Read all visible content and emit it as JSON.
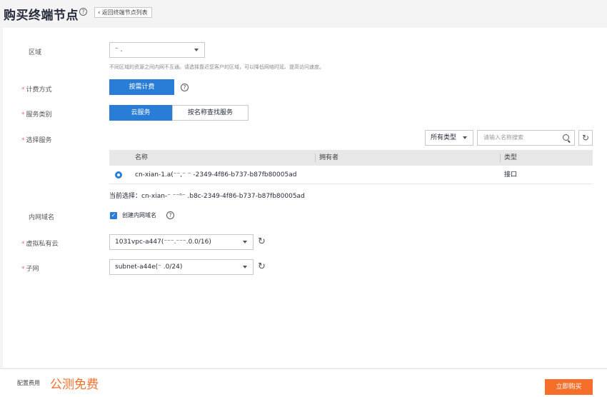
{
  "header": {
    "title": "购买终端节点",
    "help": "?",
    "back_chevron": "‹",
    "back_label": "返回终端节点列表"
  },
  "region": {
    "label": "区域",
    "value": "⁻  .",
    "hint": "不同区域的资源之间内网不互通。请选择靠近您客户的区域，可以降低网络时延、提高访问速度。"
  },
  "billing": {
    "label": "计费方式",
    "option": "按需计费",
    "help": "?"
  },
  "service_type": {
    "label": "服务类别",
    "options": [
      "云服务",
      "按名称查找服务"
    ]
  },
  "select_service": {
    "label": "选择服务",
    "type_filter": "所有类型",
    "search_placeholder": "请输入名称搜索",
    "refresh": "↻",
    "table": {
      "headers": [
        "名称",
        "拥有者",
        "类型"
      ],
      "rows": [
        {
          "name": "cn-xian-1.a(⁻⁻,⁻ ⁻ -2349-4f86-b737-b87fb80005ad",
          "owner": "",
          "type": "接口"
        }
      ]
    },
    "current": "当前选择：cn-xian-⁻ ⁻⁻ⁿ⁻ .b8c-2349-4f86-b737-b87fb80005ad"
  },
  "intranet_domain": {
    "label": "内网域名",
    "check_mark": "✓",
    "checkbox_label": "创建内网域名",
    "help": "?"
  },
  "vpc": {
    "label": "虚拟私有云",
    "value": "1031vpc-a447(⁻⁻⁻.⁻⁻⁻.0.0/16)",
    "refresh": "↻"
  },
  "subnet": {
    "label": "子网",
    "value": "subnet-a44e(⁻      .0/24)",
    "refresh": "↻"
  },
  "required_mark": "*",
  "footer": {
    "fee_label": "配置费用",
    "fee_value": "公测免费",
    "buy_label": "立即购买"
  }
}
